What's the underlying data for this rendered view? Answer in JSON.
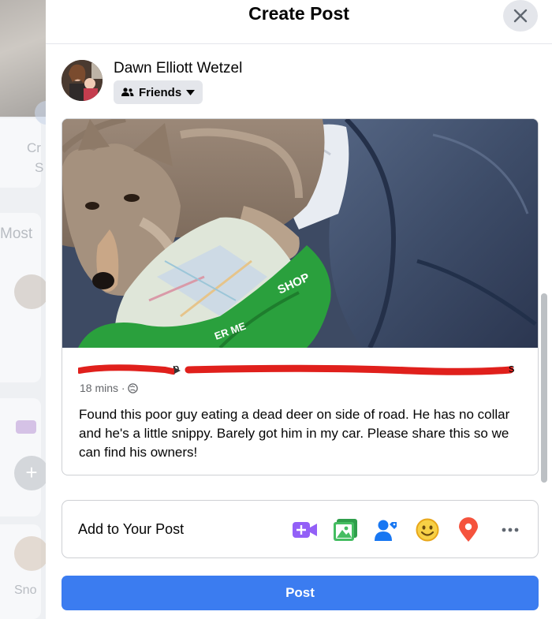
{
  "background": {
    "fragments": [
      "Cr",
      "S",
      "Most",
      "Sno"
    ]
  },
  "modal": {
    "title": "Create Post",
    "close_icon": "close-icon"
  },
  "author": {
    "name": "Dawn Elliott Wetzel",
    "audience": "Friends",
    "audience_icon": "friends-icon",
    "dropdown_icon": "caret-down-icon"
  },
  "shared_post": {
    "meta_partial_left": "p",
    "meta_partial_right": "s",
    "time": "18 mins ·",
    "privacy_icon": "globe-icon",
    "text": "Found this poor guy eating a dead deer on side of road. He has no collar and he's a little snippy. Barely got him in my car. Please share this so we can find his owners!",
    "photo_bag_text": "SHOP",
    "photo_bag_text2": "ER ME"
  },
  "add_to_post": {
    "label": "Add to Your Post",
    "tools": [
      {
        "icon": "live-video-icon",
        "color": "#9360f7"
      },
      {
        "icon": "photo-video-icon",
        "color": "#45bd62"
      },
      {
        "icon": "tag-people-icon",
        "color": "#1877f2"
      },
      {
        "icon": "feeling-icon",
        "color": "#f7b928"
      },
      {
        "icon": "check-in-icon",
        "color": "#f5533d"
      },
      {
        "icon": "more-icon",
        "color": "#606770"
      }
    ]
  },
  "actions": {
    "post": "Post"
  },
  "colors": {
    "primary": "#3b7cf0",
    "redaction": "#e0201c"
  }
}
